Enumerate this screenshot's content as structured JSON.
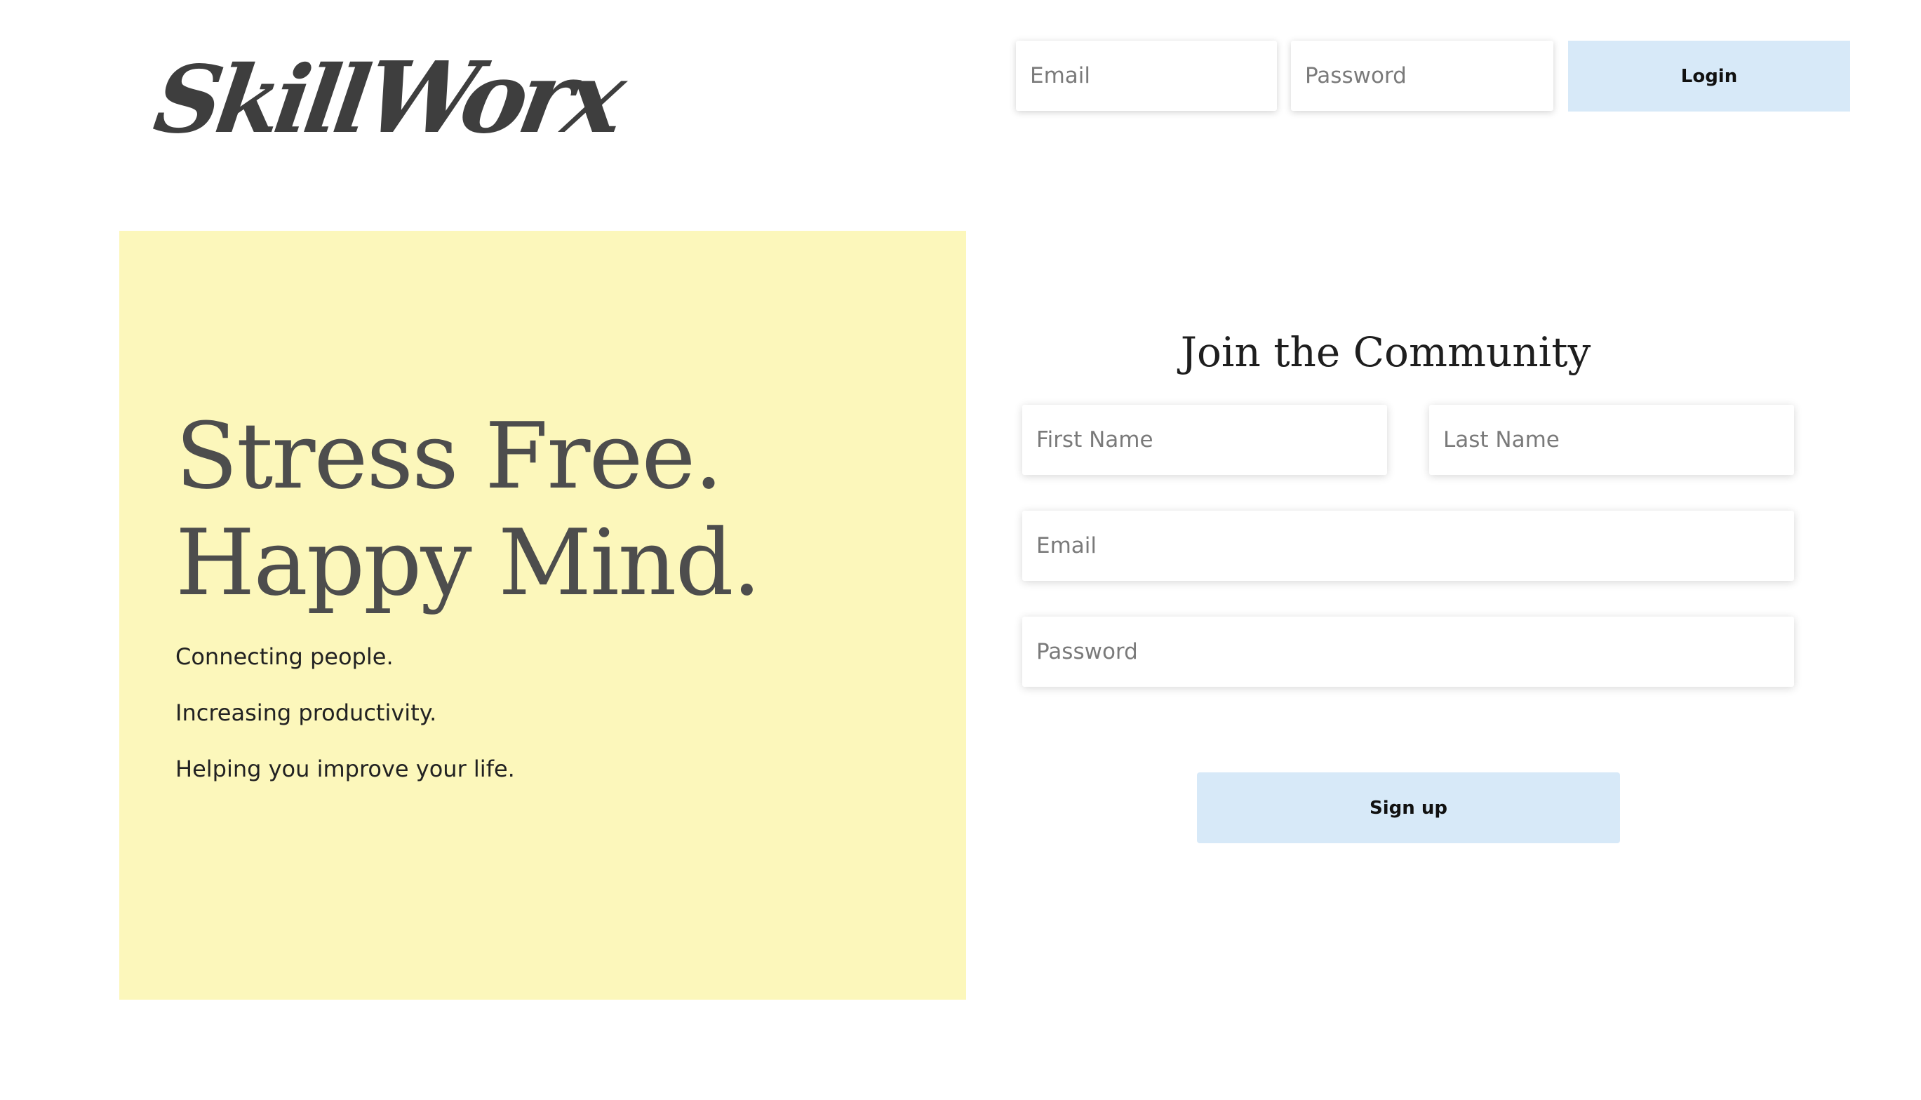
{
  "brand": {
    "logo_part1": "Skill",
    "logo_part2": "Worx",
    "logo_color": "#3e3e3e"
  },
  "header": {
    "email_placeholder": "Email",
    "password_placeholder": "Password",
    "login_label": "Login"
  },
  "hero": {
    "title_line1": "Stress Free.",
    "title_line2": "Happy Mind.",
    "lines": [
      "Connecting people.",
      "Increasing productivity.",
      "Helping you improve your life."
    ],
    "background_color": "#fcf7bb"
  },
  "signup": {
    "heading": "Join the Community",
    "first_name_placeholder": "First Name",
    "last_name_placeholder": "Last Name",
    "email_placeholder": "Email",
    "password_placeholder": "Password",
    "button_label": "Sign up"
  },
  "colors": {
    "button_background": "#d7e9f8",
    "title_text": "#4d4d4d"
  }
}
